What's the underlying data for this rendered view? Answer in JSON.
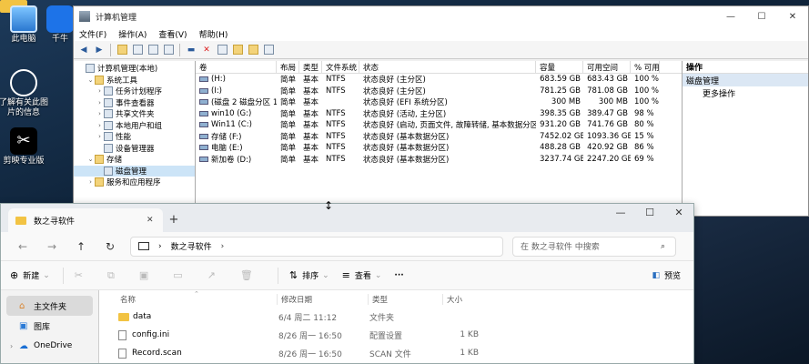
{
  "desktop": {
    "icons": [
      {
        "label": "此电脑"
      },
      {
        "label": "千牛"
      },
      {
        "label": "了解有关此图\n片的信息"
      },
      {
        "label": "剪映专业版"
      }
    ]
  },
  "computer_management": {
    "title": "计算机管理",
    "window_buttons": [
      "—",
      "☐",
      "✕"
    ],
    "menu": [
      "文件(F)",
      "操作(A)",
      "查看(V)",
      "帮助(H)"
    ],
    "tree": [
      {
        "label": "计算机管理(本地)",
        "level": 0,
        "arrow": ""
      },
      {
        "label": "系统工具",
        "level": 1,
        "arrow": "⌄"
      },
      {
        "label": "任务计划程序",
        "level": 2,
        "arrow": "›"
      },
      {
        "label": "事件查看器",
        "level": 2,
        "arrow": "›"
      },
      {
        "label": "共享文件夹",
        "level": 2,
        "arrow": "›"
      },
      {
        "label": "本地用户和组",
        "level": 2,
        "arrow": "›"
      },
      {
        "label": "性能",
        "level": 2,
        "arrow": "›"
      },
      {
        "label": "设备管理器",
        "level": 2,
        "arrow": ""
      },
      {
        "label": "存储",
        "level": 1,
        "arrow": "⌄"
      },
      {
        "label": "磁盘管理",
        "level": 2,
        "arrow": "",
        "selected": true
      },
      {
        "label": "服务和应用程序",
        "level": 1,
        "arrow": "›"
      }
    ],
    "columns": [
      "卷",
      "布局",
      "类型",
      "文件系统",
      "状态",
      "容量",
      "可用空间",
      "% 可用"
    ],
    "volumes": [
      [
        "(H:)",
        "简单",
        "基本",
        "NTFS",
        "状态良好 (主分区)",
        "683.59 GB",
        "683.43 GB",
        "100 %"
      ],
      [
        "(I:)",
        "简单",
        "基本",
        "NTFS",
        "状态良好 (主分区)",
        "781.25 GB",
        "781.08 GB",
        "100 %"
      ],
      [
        "(磁盘 2 磁盘分区 1)",
        "简单",
        "基本",
        "",
        "状态良好 (EFI 系统分区)",
        "300 MB",
        "300 MB",
        "100 %"
      ],
      [
        "win10 (G:)",
        "简单",
        "基本",
        "NTFS",
        "状态良好 (活动, 主分区)",
        "398.35 GB",
        "389.47 GB",
        "98 %"
      ],
      [
        "Win11 (C:)",
        "简单",
        "基本",
        "NTFS",
        "状态良好 (启动, 页面文件, 故障转储, 基本数据分区)",
        "931.20 GB",
        "741.76 GB",
        "80 %"
      ],
      [
        "存储 (F:)",
        "简单",
        "基本",
        "NTFS",
        "状态良好 (基本数据分区)",
        "7452.02 GB",
        "1093.36 GB",
        "15 %"
      ],
      [
        "电脑 (E:)",
        "简单",
        "基本",
        "NTFS",
        "状态良好 (基本数据分区)",
        "488.28 GB",
        "420.92 GB",
        "86 %"
      ],
      [
        "新加卷 (D:)",
        "简单",
        "基本",
        "NTFS",
        "状态良好 (基本数据分区)",
        "3237.74 GB",
        "2247.20 GB",
        "69 %"
      ]
    ],
    "actions": {
      "header": "操作",
      "selected": "磁盘管理",
      "more": "更多操作"
    }
  },
  "explorer": {
    "tab_title": "数之寻软件",
    "tab_close": "✕",
    "new_tab": "+",
    "window_buttons": [
      "—",
      "☐",
      "✕"
    ],
    "address": {
      "crumb": "数之寻软件",
      "sep1": "›",
      "sep2": "›"
    },
    "search_placeholder": "在 数之寻软件 中搜索",
    "commands": {
      "new": "新建",
      "sort": "排序",
      "view": "查看",
      "more": "···",
      "preview": "预览"
    },
    "sidebar": [
      {
        "label": "主文件夹",
        "selected": true
      },
      {
        "label": "图库"
      },
      {
        "label": "OneDrive"
      }
    ],
    "file_columns": [
      "名称",
      "修改日期",
      "类型",
      "大小"
    ],
    "files": [
      {
        "name": "data",
        "date": "6/4 周二 11:12",
        "type": "文件夹",
        "size": "",
        "kind": "folder"
      },
      {
        "name": "config.ini",
        "date": "8/26 周一 16:50",
        "type": "配置设置",
        "size": "1 KB",
        "kind": "file"
      },
      {
        "name": "Record.scan",
        "date": "8/26 周一 16:50",
        "type": "SCAN 文件",
        "size": "1 KB",
        "kind": "file"
      }
    ]
  }
}
